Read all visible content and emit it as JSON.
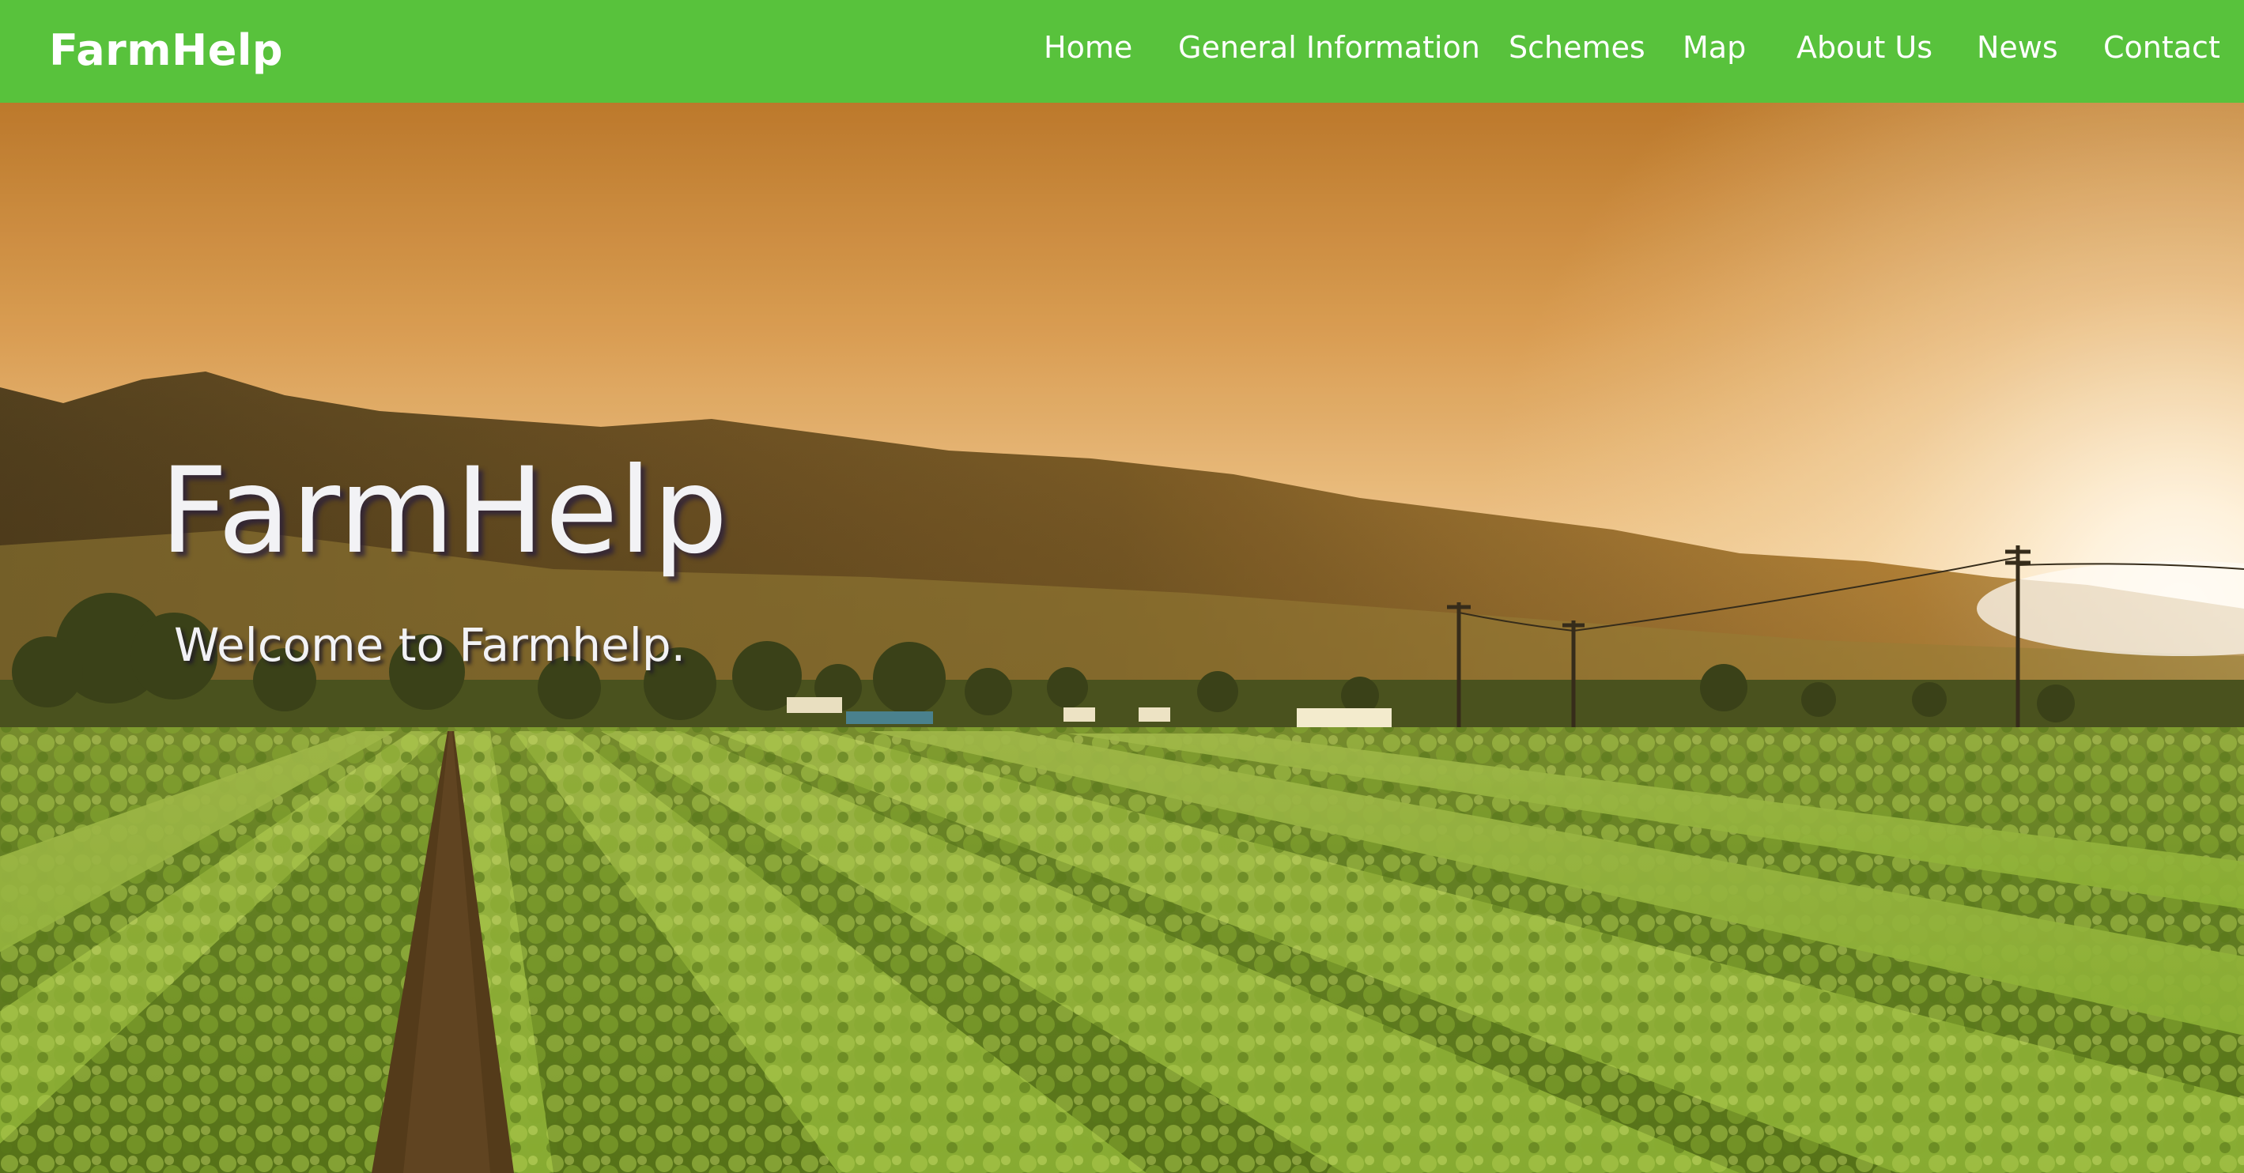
{
  "navbar": {
    "brand": "FarmHelp",
    "links": [
      {
        "label": "Home"
      },
      {
        "label": "General Information"
      },
      {
        "label": "Schemes"
      },
      {
        "label": "Map"
      },
      {
        "label": "About Us"
      },
      {
        "label": "News"
      },
      {
        "label": "Contact"
      }
    ]
  },
  "hero": {
    "title": "FarmHelp",
    "subtitle": "Welcome to Farmhelp.",
    "image": "farm-field-sunset"
  },
  "colors": {
    "navbar": "#58c23c",
    "hero_text": "#f2f2f5"
  }
}
